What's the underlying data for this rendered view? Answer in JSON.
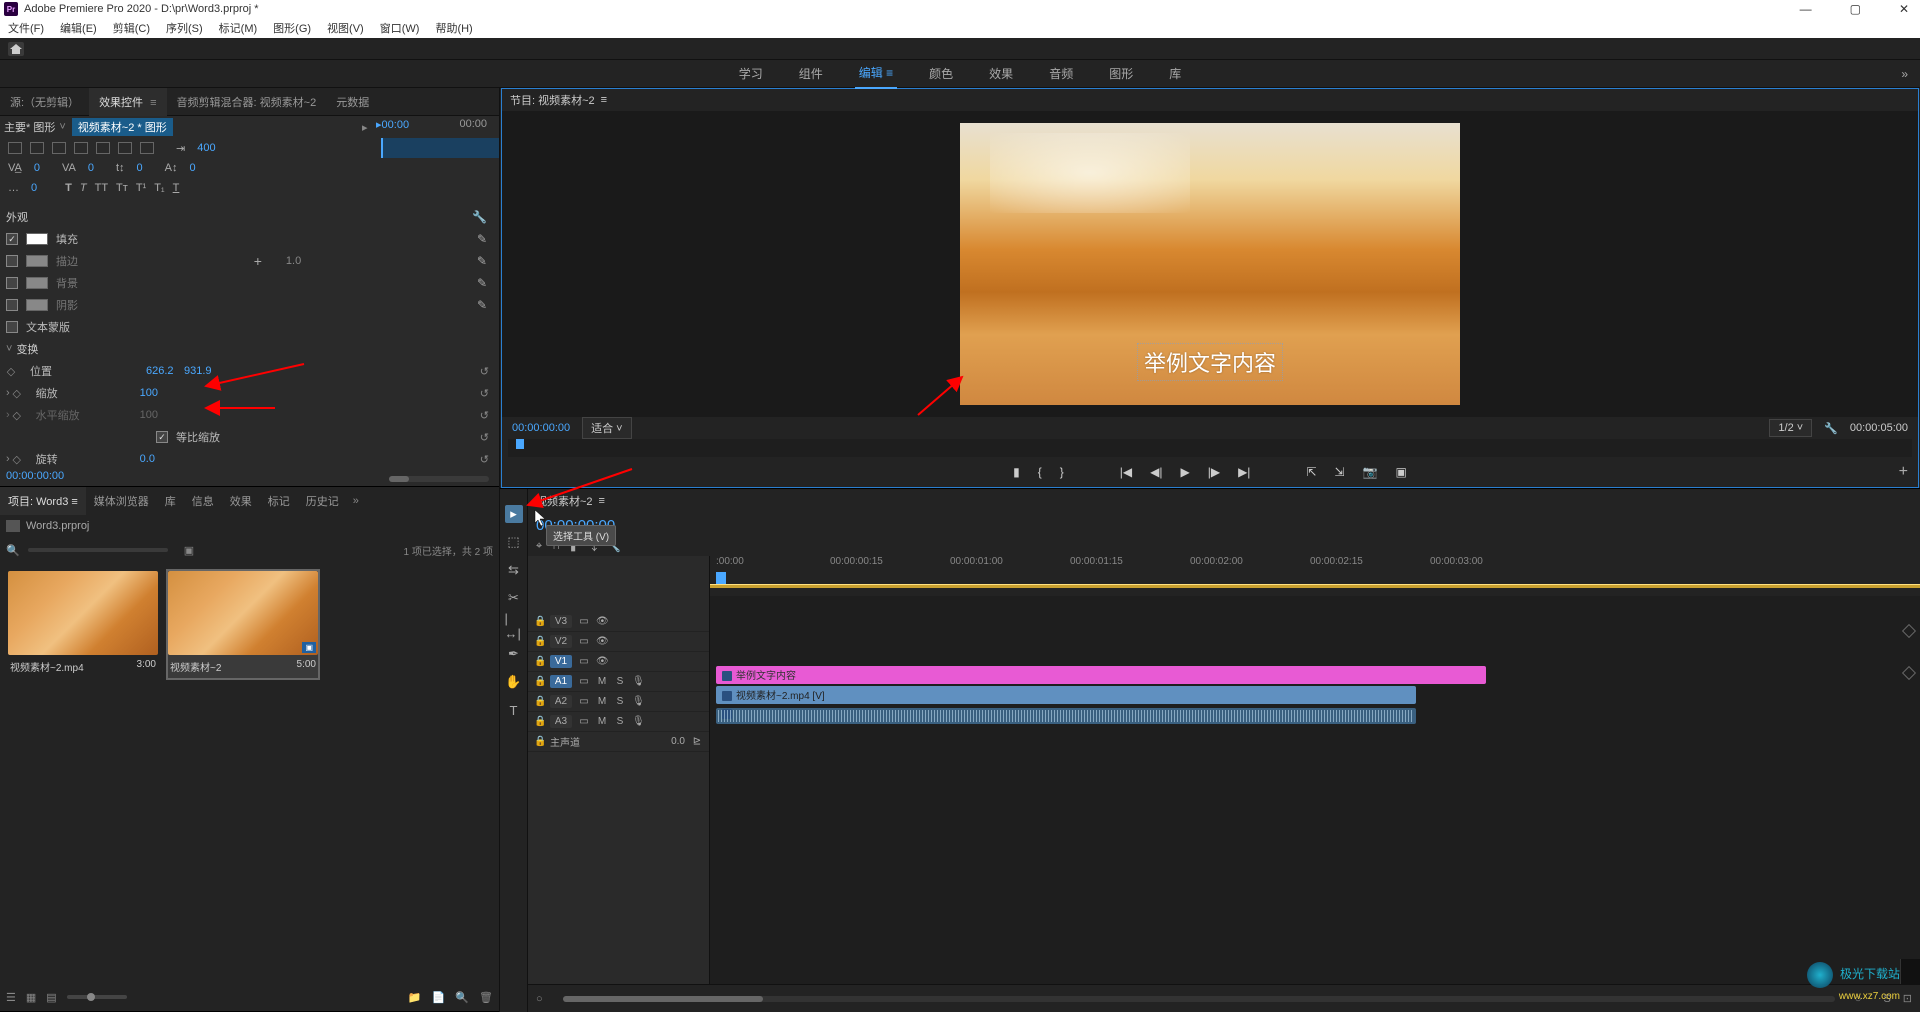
{
  "titlebar": {
    "app": "Adobe Premiere Pro 2020",
    "path": "D:\\pr\\Word3.prproj *"
  },
  "menu": [
    "文件(F)",
    "编辑(E)",
    "剪辑(C)",
    "序列(S)",
    "标记(M)",
    "图形(G)",
    "视图(V)",
    "窗口(W)",
    "帮助(H)"
  ],
  "workspace_tabs": [
    "学习",
    "组件",
    "编辑",
    "颜色",
    "效果",
    "音频",
    "图形",
    "库"
  ],
  "workspace_active": 2,
  "source_tabs": [
    "源:（无剪辑）",
    "效果控件",
    "音频剪辑混合器: 视频素材~2",
    "元数据"
  ],
  "source_active": 1,
  "fx": {
    "breadcrumb1": "主要* 图形",
    "breadcrumb2": "视频素材~2 * 图形",
    "tc_start": "00:00",
    "tc_end": "00:00",
    "fmt_val": "400",
    "kern1": "0",
    "kern2": "0",
    "kern3": "0",
    "kern4": "0",
    "lead": "0",
    "section_appearance": "外观",
    "fill": "填充",
    "stroke": "描边",
    "stroke_val": "1.0",
    "background": "背景",
    "shadow": "阴影",
    "textmask": "文本蒙版",
    "section_transform": "变换",
    "position": "位置",
    "pos_x": "626.2",
    "pos_y": "931.9",
    "scale": "缩放",
    "scale_val": "100",
    "scale_h": "水平缩放",
    "scale_h_val": "100",
    "uniform": "等比缩放",
    "rotation": "旋转",
    "rotation_val": "0.0",
    "timecode": "00:00:00:00"
  },
  "project_tabs": [
    "项目: Word3",
    "媒体浏览器",
    "库",
    "信息",
    "效果",
    "标记",
    "历史记"
  ],
  "project_active": 0,
  "project": {
    "bin_name": "Word3.prproj",
    "status": "1 项已选择，共 2 项",
    "items": [
      {
        "name": "视频素材~2.mp4",
        "dur": "3:00",
        "badge": ""
      },
      {
        "name": "视频素材~2",
        "dur": "5:00",
        "badge": ""
      }
    ]
  },
  "program": {
    "title": "节目: 视频素材~2",
    "subtitle_text": "举例文字内容",
    "tc": "00:00:00:00",
    "fit": "适合",
    "res": "1/2",
    "dur": "00:00:05:00"
  },
  "timeline": {
    "seq_name": "视频素材~2",
    "tc": "00:00:00:00",
    "tooltip": "选择工具 (V)",
    "ticks": [
      ":00:00",
      "00:00:00:15",
      "00:00:01:00",
      "00:00:01:15",
      "00:00:02:00",
      "00:00:02:15",
      "00:00:03:00"
    ],
    "tracks_v": [
      "V3",
      "V2",
      "V1"
    ],
    "tracks_a": [
      "A1",
      "A2",
      "A3"
    ],
    "master": "主声道",
    "master_val": "0.0",
    "clip_text": "举例文字内容",
    "clip_video": "视频素材~2.mp4 [V]"
  },
  "watermark": {
    "line1": "极光下载站",
    "line2": "www.xz7.com"
  }
}
